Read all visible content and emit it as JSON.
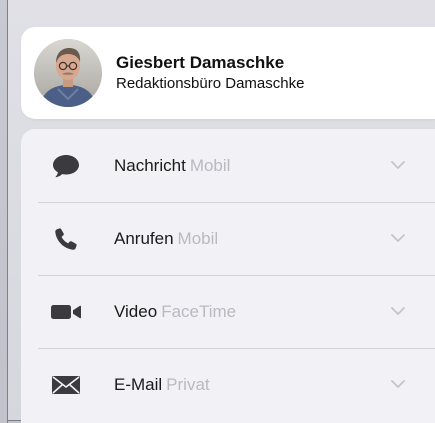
{
  "contact": {
    "name": "Giesbert Damaschke",
    "company": "Redaktionsbüro Damaschke",
    "avatar_icon": "person-photo"
  },
  "actions": [
    {
      "label": "Nachricht",
      "detail": "Mobil",
      "icon": "message-bubble-icon"
    },
    {
      "label": "Anrufen",
      "detail": "Mobil",
      "icon": "phone-icon"
    },
    {
      "label": "Video",
      "detail": "FaceTime",
      "icon": "video-camera-icon"
    },
    {
      "label": "E-Mail",
      "detail": "Privat",
      "icon": "envelope-icon"
    }
  ],
  "colors": {
    "icon": "#3b3b3f",
    "secondary_text": "#b9b9bf",
    "chevron": "#c4c4c9"
  }
}
